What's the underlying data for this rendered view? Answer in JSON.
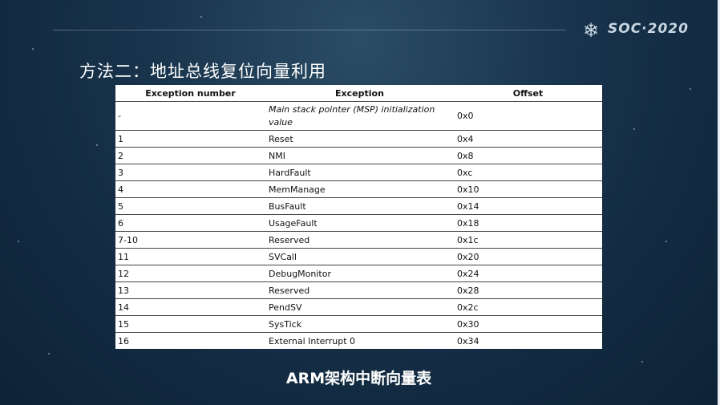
{
  "header": {
    "brand": "SOC·2020",
    "icon": "snowflake-icon"
  },
  "slide_title": "方法二：地址总线复位向量利用",
  "table": {
    "columns": [
      "Exception number",
      "Exception",
      "Offset"
    ],
    "rows": [
      {
        "number": "-",
        "exception": "Main stack pointer (MSP) initialization value",
        "offset": "0x0",
        "italic": true
      },
      {
        "number": "1",
        "exception": "Reset",
        "offset": "0x4"
      },
      {
        "number": "2",
        "exception": "NMI",
        "offset": "0x8"
      },
      {
        "number": "3",
        "exception": "HardFault",
        "offset": "0xc"
      },
      {
        "number": "4",
        "exception": "MemManage",
        "offset": "0x10"
      },
      {
        "number": "5",
        "exception": "BusFault",
        "offset": "0x14"
      },
      {
        "number": "6",
        "exception": "UsageFault",
        "offset": "0x18"
      },
      {
        "number": "7-10",
        "exception": "Reserved",
        "offset": "0x1c"
      },
      {
        "number": "11",
        "exception": "SVCall",
        "offset": "0x20"
      },
      {
        "number": "12",
        "exception": "DebugMonitor",
        "offset": "0x24"
      },
      {
        "number": "13",
        "exception": "Reserved",
        "offset": "0x28"
      },
      {
        "number": "14",
        "exception": "PendSV",
        "offset": "0x2c"
      },
      {
        "number": "15",
        "exception": "SysTick",
        "offset": "0x30"
      },
      {
        "number": "16",
        "exception": "External Interrupt 0",
        "offset": "0x34"
      }
    ]
  },
  "caption": "ARM架构中断向量表",
  "colors": {
    "background": "#17324a",
    "text": "#ffffff",
    "table_bg": "#ffffff"
  }
}
